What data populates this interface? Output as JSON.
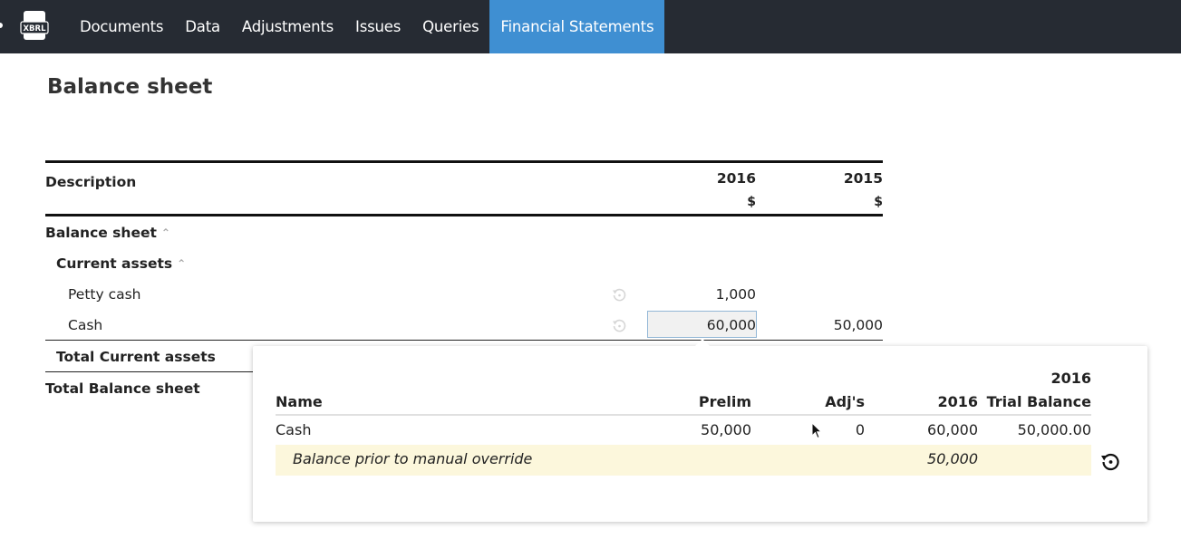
{
  "nav": {
    "logo_text": "XBRL",
    "items": [
      {
        "label": "Documents"
      },
      {
        "label": "Data"
      },
      {
        "label": "Adjustments"
      },
      {
        "label": "Issues"
      },
      {
        "label": "Queries"
      },
      {
        "label": "Financial Statements",
        "active": true
      }
    ]
  },
  "page": {
    "title": "Balance sheet"
  },
  "statement": {
    "header": {
      "description": "Description",
      "year1": "2016",
      "year2": "2015",
      "currency1": "$",
      "currency2": "$"
    },
    "rows": [
      {
        "label": "Balance sheet",
        "level": 0,
        "bold": true,
        "collapsible": true
      },
      {
        "label": "Current assets",
        "level": 1,
        "bold": true,
        "collapsible": true
      },
      {
        "label": "Petty cash",
        "level": 2,
        "v2016": "1,000",
        "v2015": "",
        "history_icon": "history-icon"
      },
      {
        "label": "Cash",
        "level": 2,
        "v2016": "60,000",
        "v2015": "50,000",
        "history_icon": "history-icon",
        "selected": true
      },
      {
        "label": "Total Current assets",
        "level": 1,
        "bold": true
      },
      {
        "label": "Total Balance sheet",
        "level": 0,
        "bold": true
      }
    ]
  },
  "popover": {
    "columns": {
      "name": "Name",
      "prelim": "Prelim",
      "adjs": "Adj's",
      "current": "2016",
      "tb_year": "2016",
      "tb": "Trial Balance"
    },
    "row": {
      "name": "Cash",
      "prelim": "50,000",
      "adjs": "0",
      "current": "60,000",
      "tb": "50,000.00"
    },
    "override": {
      "label": "Balance prior to manual override",
      "value": "50,000",
      "restore_icon": "restore-icon"
    }
  },
  "colors": {
    "topbar": "#262b33",
    "active_tab": "#3f8fd2",
    "override_bg": "#fcf7dc"
  }
}
